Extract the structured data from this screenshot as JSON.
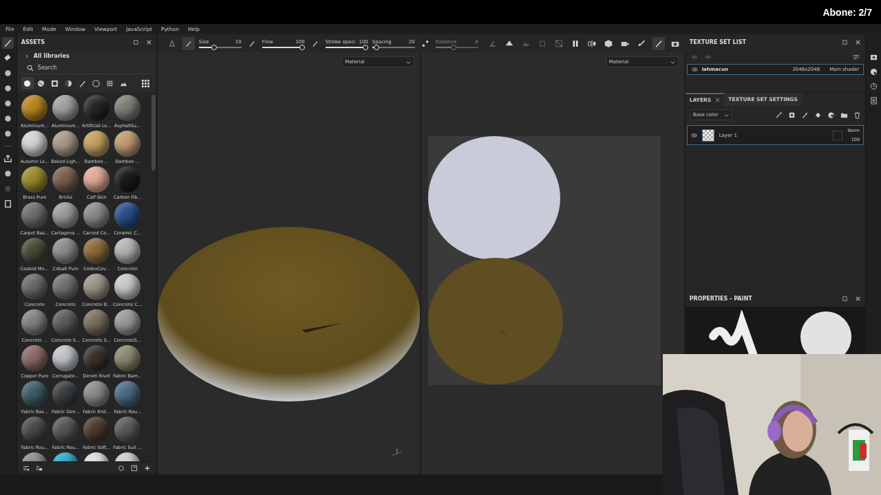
{
  "overlay": {
    "counter": "Abone: 2/7"
  },
  "menu": [
    "File",
    "Edit",
    "Mode",
    "Window",
    "Viewport",
    "JavaScript",
    "Python",
    "Help"
  ],
  "assets": {
    "title": "ASSETS",
    "library": "All libraries",
    "search": {
      "placeholder": "Search"
    },
    "filters": [
      {
        "kind": "material",
        "selected": true
      },
      {
        "kind": "smart",
        "selected": false
      },
      {
        "kind": "mask",
        "selected": false
      },
      {
        "kind": "filter",
        "selected": false
      },
      {
        "kind": "brush",
        "selected": false
      },
      {
        "kind": "particle",
        "selected": false
      },
      {
        "kind": "texture",
        "selected": false
      },
      {
        "kind": "environment",
        "selected": false
      }
    ],
    "materials": [
      {
        "name": "Aluminium...",
        "color": "#b8861e"
      },
      {
        "name": "Aluminium...",
        "color": "#a0a0a0"
      },
      {
        "name": "Artificial Le...",
        "color": "#262626"
      },
      {
        "name": "AsphaltSu...",
        "color": "#7d7f76"
      },
      {
        "name": "Autumn Le...",
        "color": "#d4d4d4"
      },
      {
        "name": "Baked Ligh...",
        "color": "#a89a88"
      },
      {
        "name": "Bamboo ...",
        "color": "#c4a060"
      },
      {
        "name": "Bamboo ...",
        "color": "#c09a74"
      },
      {
        "name": "Brass Pure",
        "color": "#9a8a30"
      },
      {
        "name": "Bricks",
        "color": "#7a6050"
      },
      {
        "name": "Calf Skin",
        "color": "#e0a898"
      },
      {
        "name": "Carbon Fib...",
        "color": "#1c1c1c"
      },
      {
        "name": "Carpet Bas...",
        "color": "#6e6e6e"
      },
      {
        "name": "Cartagena ...",
        "color": "#9c9c9c"
      },
      {
        "name": "Carved Co...",
        "color": "#8a8a8a"
      },
      {
        "name": "Ceramic C...",
        "color": "#2a4e8a"
      },
      {
        "name": "Coated Me...",
        "color": "#4a4a38"
      },
      {
        "name": "Cobalt Pure",
        "color": "#8c8c8c"
      },
      {
        "name": "CodexCov...",
        "color": "#8a6a3a"
      },
      {
        "name": "Concrete",
        "color": "#b4b4b4"
      },
      {
        "name": "Concrete",
        "color": "#6a6a6a"
      },
      {
        "name": "Concrete",
        "color": "#727272"
      },
      {
        "name": "Concrete B...",
        "color": "#9a9488"
      },
      {
        "name": "Concrete C...",
        "color": "#c8c8c8"
      },
      {
        "name": "Concrete ...",
        "color": "#828282"
      },
      {
        "name": "Concrete S...",
        "color": "#5c5c5c"
      },
      {
        "name": "Concrete S...",
        "color": "#7a7060"
      },
      {
        "name": "ConcreteS...",
        "color": "#9a9a9a"
      },
      {
        "name": "Copper Pure",
        "color": "#8a6a68"
      },
      {
        "name": "Corrugate...",
        "color": "#c0c4c8"
      },
      {
        "name": "Denim Rivet",
        "color": "#3a3028"
      },
      {
        "name": "Fabric Bam...",
        "color": "#8a8870"
      },
      {
        "name": "Fabric Bas...",
        "color": "#3e5c68"
      },
      {
        "name": "Fabric Den...",
        "color": "#3a3e40"
      },
      {
        "name": "Fabric Knit...",
        "color": "#8a8a8a"
      },
      {
        "name": "Fabric Rou...",
        "color": "#4a6a88"
      },
      {
        "name": "Fabric Rou...",
        "color": "#4a4a4a"
      },
      {
        "name": "Fabric Rou...",
        "color": "#565656"
      },
      {
        "name": "Fabric Soft...",
        "color": "#4a3a30"
      },
      {
        "name": "Fabric Suit ...",
        "color": "#5a5a5a"
      },
      {
        "color": "#8a8a8a"
      },
      {
        "color": "#2aa8c8"
      },
      {
        "color": "#dddddd"
      },
      {
        "color": "#cccccc"
      }
    ]
  },
  "toolbar": {
    "sliders": [
      {
        "label": "Size",
        "value": "10",
        "level": 0.33,
        "disabled": false
      },
      {
        "label": "Flow",
        "value": "100",
        "level": 1,
        "disabled": false
      },
      {
        "label": "Stroke opaci",
        "value": "100",
        "level": 1,
        "disabled": false
      },
      {
        "label": "Spacing",
        "value": "20",
        "level": 0.05,
        "disabled": false
      },
      {
        "label": "Distance",
        "value": "8",
        "level": 0.42,
        "disabled": true
      }
    ]
  },
  "viewports": [
    {
      "kind": "perspective",
      "mode": "Material"
    },
    {
      "kind": "uv",
      "mode": "Material"
    }
  ],
  "texture_set_list": {
    "title": "TEXTURE SET LIST",
    "rows": [
      {
        "name": "lahmacun",
        "size": "2048x2048",
        "shader": "Main shader",
        "selected": true
      }
    ]
  },
  "layers": {
    "tabs": [
      {
        "label": "LAYERS",
        "selected": true
      },
      {
        "label": "TEXTURE SET SETTINGS",
        "selected": false
      }
    ],
    "channel": "Base color",
    "items": [
      {
        "name": "Layer 1",
        "blend": "Norm",
        "opacity": "100",
        "visible": true,
        "selected": true
      }
    ]
  },
  "properties": {
    "title": "PROPERTIES - PAINT"
  }
}
